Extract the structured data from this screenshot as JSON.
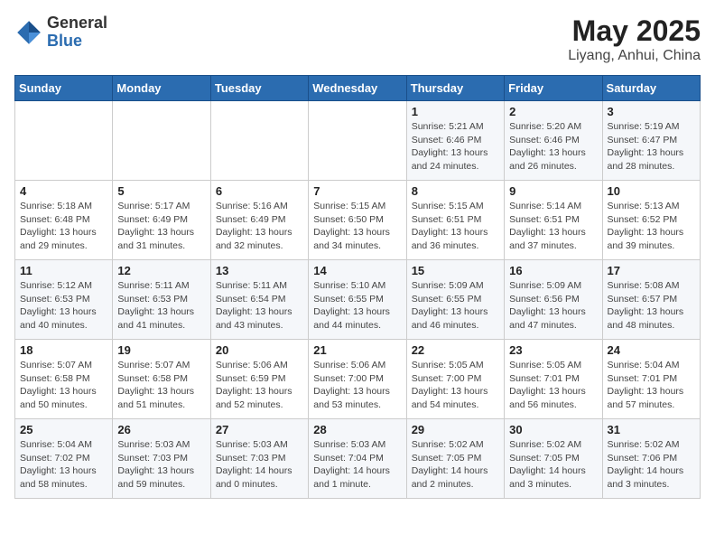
{
  "logo": {
    "general": "General",
    "blue": "Blue"
  },
  "title": "May 2025",
  "subtitle": "Liyang, Anhui, China",
  "days_of_week": [
    "Sunday",
    "Monday",
    "Tuesday",
    "Wednesday",
    "Thursday",
    "Friday",
    "Saturday"
  ],
  "weeks": [
    [
      {
        "day": "",
        "info": ""
      },
      {
        "day": "",
        "info": ""
      },
      {
        "day": "",
        "info": ""
      },
      {
        "day": "",
        "info": ""
      },
      {
        "day": "1",
        "info": "Sunrise: 5:21 AM\nSunset: 6:46 PM\nDaylight: 13 hours\nand 24 minutes."
      },
      {
        "day": "2",
        "info": "Sunrise: 5:20 AM\nSunset: 6:46 PM\nDaylight: 13 hours\nand 26 minutes."
      },
      {
        "day": "3",
        "info": "Sunrise: 5:19 AM\nSunset: 6:47 PM\nDaylight: 13 hours\nand 28 minutes."
      }
    ],
    [
      {
        "day": "4",
        "info": "Sunrise: 5:18 AM\nSunset: 6:48 PM\nDaylight: 13 hours\nand 29 minutes."
      },
      {
        "day": "5",
        "info": "Sunrise: 5:17 AM\nSunset: 6:49 PM\nDaylight: 13 hours\nand 31 minutes."
      },
      {
        "day": "6",
        "info": "Sunrise: 5:16 AM\nSunset: 6:49 PM\nDaylight: 13 hours\nand 32 minutes."
      },
      {
        "day": "7",
        "info": "Sunrise: 5:15 AM\nSunset: 6:50 PM\nDaylight: 13 hours\nand 34 minutes."
      },
      {
        "day": "8",
        "info": "Sunrise: 5:15 AM\nSunset: 6:51 PM\nDaylight: 13 hours\nand 36 minutes."
      },
      {
        "day": "9",
        "info": "Sunrise: 5:14 AM\nSunset: 6:51 PM\nDaylight: 13 hours\nand 37 minutes."
      },
      {
        "day": "10",
        "info": "Sunrise: 5:13 AM\nSunset: 6:52 PM\nDaylight: 13 hours\nand 39 minutes."
      }
    ],
    [
      {
        "day": "11",
        "info": "Sunrise: 5:12 AM\nSunset: 6:53 PM\nDaylight: 13 hours\nand 40 minutes."
      },
      {
        "day": "12",
        "info": "Sunrise: 5:11 AM\nSunset: 6:53 PM\nDaylight: 13 hours\nand 41 minutes."
      },
      {
        "day": "13",
        "info": "Sunrise: 5:11 AM\nSunset: 6:54 PM\nDaylight: 13 hours\nand 43 minutes."
      },
      {
        "day": "14",
        "info": "Sunrise: 5:10 AM\nSunset: 6:55 PM\nDaylight: 13 hours\nand 44 minutes."
      },
      {
        "day": "15",
        "info": "Sunrise: 5:09 AM\nSunset: 6:55 PM\nDaylight: 13 hours\nand 46 minutes."
      },
      {
        "day": "16",
        "info": "Sunrise: 5:09 AM\nSunset: 6:56 PM\nDaylight: 13 hours\nand 47 minutes."
      },
      {
        "day": "17",
        "info": "Sunrise: 5:08 AM\nSunset: 6:57 PM\nDaylight: 13 hours\nand 48 minutes."
      }
    ],
    [
      {
        "day": "18",
        "info": "Sunrise: 5:07 AM\nSunset: 6:58 PM\nDaylight: 13 hours\nand 50 minutes."
      },
      {
        "day": "19",
        "info": "Sunrise: 5:07 AM\nSunset: 6:58 PM\nDaylight: 13 hours\nand 51 minutes."
      },
      {
        "day": "20",
        "info": "Sunrise: 5:06 AM\nSunset: 6:59 PM\nDaylight: 13 hours\nand 52 minutes."
      },
      {
        "day": "21",
        "info": "Sunrise: 5:06 AM\nSunset: 7:00 PM\nDaylight: 13 hours\nand 53 minutes."
      },
      {
        "day": "22",
        "info": "Sunrise: 5:05 AM\nSunset: 7:00 PM\nDaylight: 13 hours\nand 54 minutes."
      },
      {
        "day": "23",
        "info": "Sunrise: 5:05 AM\nSunset: 7:01 PM\nDaylight: 13 hours\nand 56 minutes."
      },
      {
        "day": "24",
        "info": "Sunrise: 5:04 AM\nSunset: 7:01 PM\nDaylight: 13 hours\nand 57 minutes."
      }
    ],
    [
      {
        "day": "25",
        "info": "Sunrise: 5:04 AM\nSunset: 7:02 PM\nDaylight: 13 hours\nand 58 minutes."
      },
      {
        "day": "26",
        "info": "Sunrise: 5:03 AM\nSunset: 7:03 PM\nDaylight: 13 hours\nand 59 minutes."
      },
      {
        "day": "27",
        "info": "Sunrise: 5:03 AM\nSunset: 7:03 PM\nDaylight: 14 hours\nand 0 minutes."
      },
      {
        "day": "28",
        "info": "Sunrise: 5:03 AM\nSunset: 7:04 PM\nDaylight: 14 hours\nand 1 minute."
      },
      {
        "day": "29",
        "info": "Sunrise: 5:02 AM\nSunset: 7:05 PM\nDaylight: 14 hours\nand 2 minutes."
      },
      {
        "day": "30",
        "info": "Sunrise: 5:02 AM\nSunset: 7:05 PM\nDaylight: 14 hours\nand 3 minutes."
      },
      {
        "day": "31",
        "info": "Sunrise: 5:02 AM\nSunset: 7:06 PM\nDaylight: 14 hours\nand 3 minutes."
      }
    ]
  ]
}
